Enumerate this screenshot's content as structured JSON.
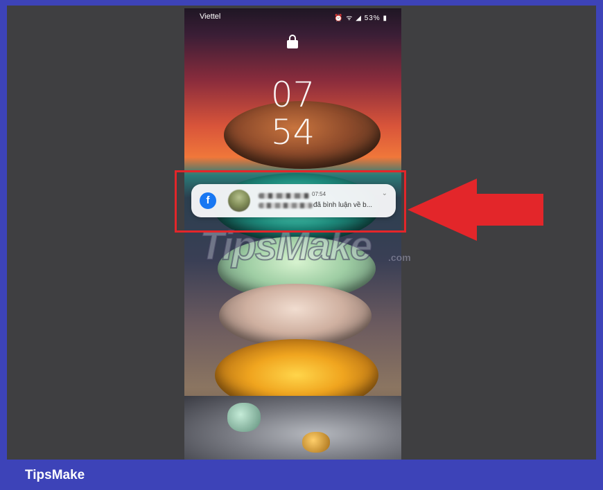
{
  "status_bar": {
    "carrier": "Viettel",
    "battery": "53%"
  },
  "clock": {
    "hour": "07",
    "minute": "54"
  },
  "notification": {
    "app_icon": "facebook-icon",
    "time": "07:54",
    "message": "đã bình luận về b..."
  },
  "watermark": {
    "main": "TipsMake",
    "suffix": ".com"
  },
  "footer": {
    "brand": "TipsMake"
  },
  "colors": {
    "frame": "#3d43b8",
    "highlight": "#e3262a",
    "arrow": "#e3262a",
    "facebook": "#1877f2"
  }
}
